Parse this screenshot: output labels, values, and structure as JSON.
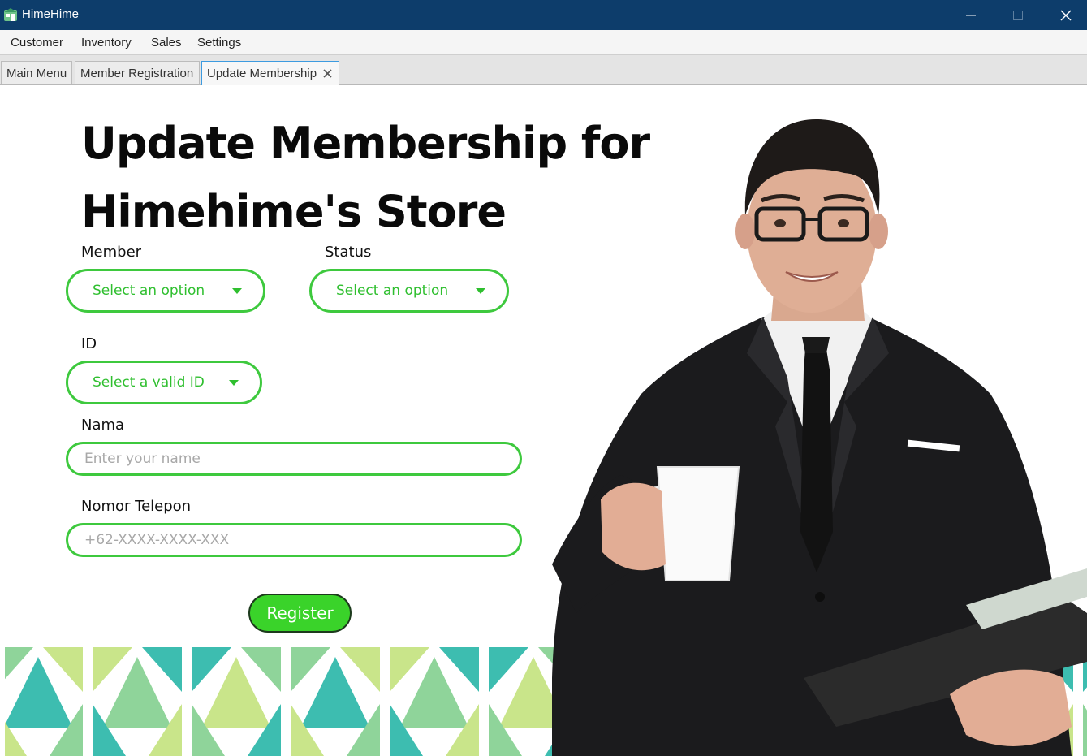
{
  "window": {
    "title": "HimeHime",
    "icon": "store-logo-icon",
    "controls": [
      "minimize-icon",
      "maximize-icon",
      "close-icon"
    ],
    "titlebar_color": "#0d3d6b"
  },
  "menu": {
    "items": [
      "Customer",
      "Inventory",
      "Sales",
      "Settings"
    ]
  },
  "tabs": [
    {
      "label": "Main Menu",
      "active": false
    },
    {
      "label": "Member Registration",
      "active": false
    },
    {
      "label": "Update Membership",
      "active": true,
      "closable": true
    }
  ],
  "form": {
    "heading_line1": "Update Membership for",
    "heading_line2": "Himehime's Store",
    "member": {
      "label": "Member",
      "value": "Select an option"
    },
    "status": {
      "label": "Status",
      "value": "Select an option"
    },
    "id": {
      "label": "ID",
      "value": "Select a valid ID"
    },
    "nama": {
      "label": "Nama",
      "placeholder": "Enter your name",
      "value": ""
    },
    "phone": {
      "label": "Nomor Telepon",
      "placeholder": "+62-XXXX-XXXX-XXX",
      "value": ""
    },
    "submit_label": "Register"
  },
  "colors": {
    "accent_green": "#3ec93e",
    "button_green": "#3ad32a",
    "pattern_teal": "#3dbdb0",
    "pattern_light_green": "#8fd49a",
    "pattern_lime": "#c9e58a"
  }
}
